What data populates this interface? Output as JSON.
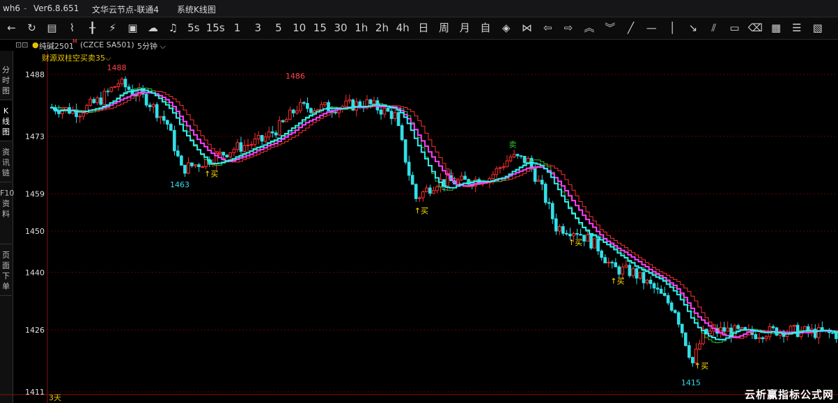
{
  "window": {
    "app": "wh6",
    "version": "Ver6.8.651",
    "server": "文华云节点-联通4",
    "view": "系统K线图"
  },
  "toolbar": {
    "icons": [
      "back-arrow-icon",
      "refresh-icon",
      "list-icon",
      "line-chart-icon",
      "candle-icon",
      "stock-trend-icon",
      "frame-icon",
      "cloud-icon",
      "bell-icon"
    ],
    "periods": [
      "5s",
      "15s",
      "1",
      "3",
      "5",
      "10",
      "15",
      "30",
      "1h",
      "2h",
      "4h",
      "日",
      "周",
      "月",
      "自"
    ],
    "draw_icons": [
      "diamond-icon",
      "butterfly-icon",
      "left-arrow-icon",
      "right-arrow-icon",
      "double-up-icon",
      "double-down-icon",
      "slash-line-icon",
      "horizontal-line-icon",
      "vertical-line-icon",
      "ray-icon",
      "parallel-line-icon",
      "rectangle-icon",
      "eraser-icon",
      "text-icon",
      "fibonacci-icon",
      "more-icon"
    ]
  },
  "infobar": {
    "contract": "纯碱2501",
    "marker": "M",
    "code": "(CZCE SA501)",
    "period": "5分钟"
  },
  "indicator": {
    "name": "财源双柱空买卖",
    "param": "35"
  },
  "sidebar": {
    "tabs": [
      "分时图",
      "K线图",
      "资讯链",
      "F10资料",
      "页面下单"
    ],
    "active": 1
  },
  "chart_data": {
    "type": "candlestick",
    "y_ticks": [
      1488,
      1473,
      1459,
      1450,
      1440,
      1426,
      1411
    ],
    "ylim": [
      1411,
      1490
    ],
    "annotations": [
      {
        "label": "1488",
        "value": 1488,
        "bar": 19,
        "color": "#ff4444"
      },
      {
        "label": "1486",
        "value": 1486,
        "bar": 70,
        "color": "#ff4444"
      },
      {
        "label": "1463",
        "value": 1463,
        "bar": 37,
        "color": "#33ddee"
      },
      {
        "label": "1415",
        "value": 1415,
        "bar": 183,
        "color": "#33ddee"
      }
    ],
    "signals": [
      {
        "text": "↑买",
        "bar": 44,
        "type": "buy"
      },
      {
        "text": "↑买",
        "bar": 104,
        "type": "buy"
      },
      {
        "text": "卖",
        "bar": 131,
        "type": "sell"
      },
      {
        "text": "↑买",
        "bar": 148,
        "type": "buy"
      },
      {
        "text": "↑买",
        "bar": 160,
        "type": "buy"
      },
      {
        "text": "↑买",
        "bar": 184,
        "type": "buy"
      }
    ],
    "footer": "3天",
    "colors": {
      "up": "#ff3030",
      "down": "#30e0e8",
      "ma1": "#ff3030",
      "ma2": "#30c030",
      "ma_cyan": "#30f0f0",
      "ma_magenta": "#ff40ff",
      "grid": "#6a0000"
    }
  },
  "watermark": "云析赢指标公式网"
}
